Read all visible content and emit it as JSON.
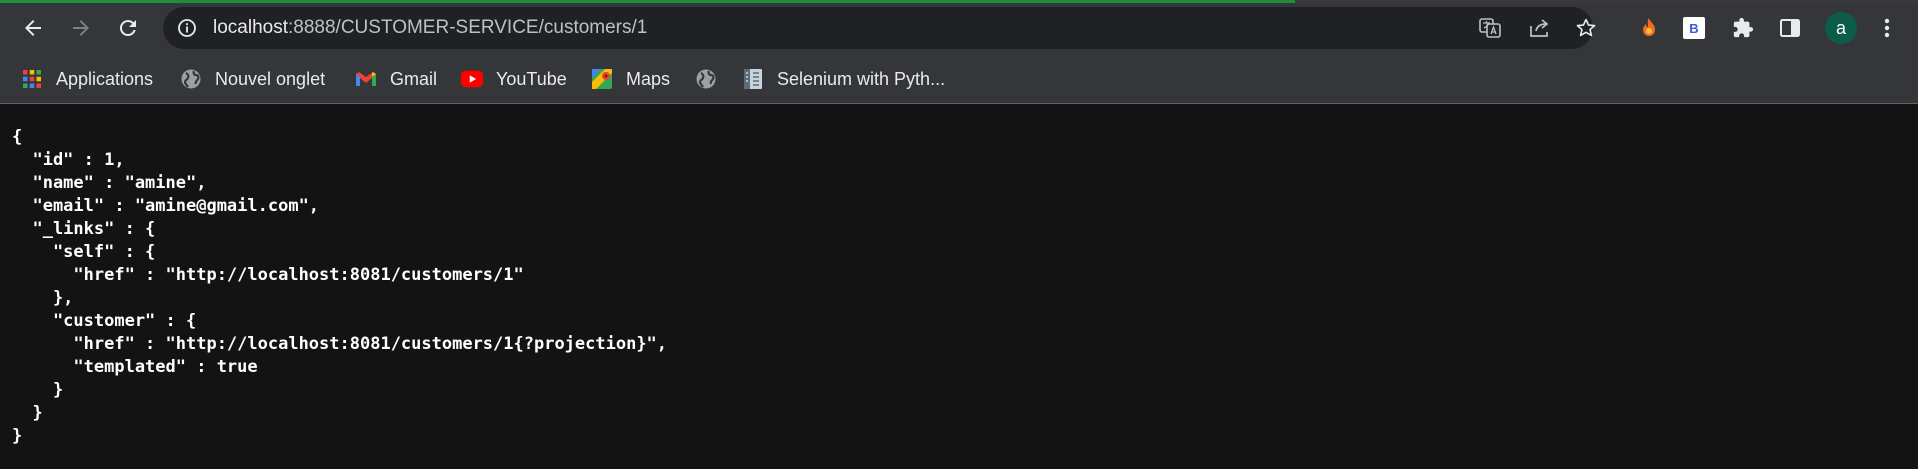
{
  "browser": {
    "url_host": "localhost",
    "url_rest": ":8888/CUSTOMER-SERVICE/customers/1",
    "load_progress": 0.675,
    "profile_initial": "a",
    "ext_b_label": "B"
  },
  "bookmarks": [
    {
      "label": "Applications",
      "icon": "apps-grid-icon"
    },
    {
      "label": "Nouvel onglet",
      "icon": "globe-icon"
    },
    {
      "label": "Gmail",
      "icon": "gmail-icon"
    },
    {
      "label": "YouTube",
      "icon": "youtube-icon"
    },
    {
      "label": "Maps",
      "icon": "maps-icon"
    },
    {
      "label": "",
      "icon": "globe-icon"
    },
    {
      "label": "Selenium with Pyth...",
      "icon": "selenium-doc-icon"
    }
  ],
  "json_body": "{\n  \"id\" : 1,\n  \"name\" : \"amine\",\n  \"email\" : \"amine@gmail.com\",\n  \"_links\" : {\n    \"self\" : {\n      \"href\" : \"http://localhost:8081/customers/1\"\n    },\n    \"customer\" : {\n      \"href\" : \"http://localhost:8081/customers/1{?projection}\",\n      \"templated\" : true\n    }\n  }\n}",
  "colors": {
    "toolbar": "#35363a",
    "page_bg": "#131313",
    "progress": "#1e8e3e"
  }
}
